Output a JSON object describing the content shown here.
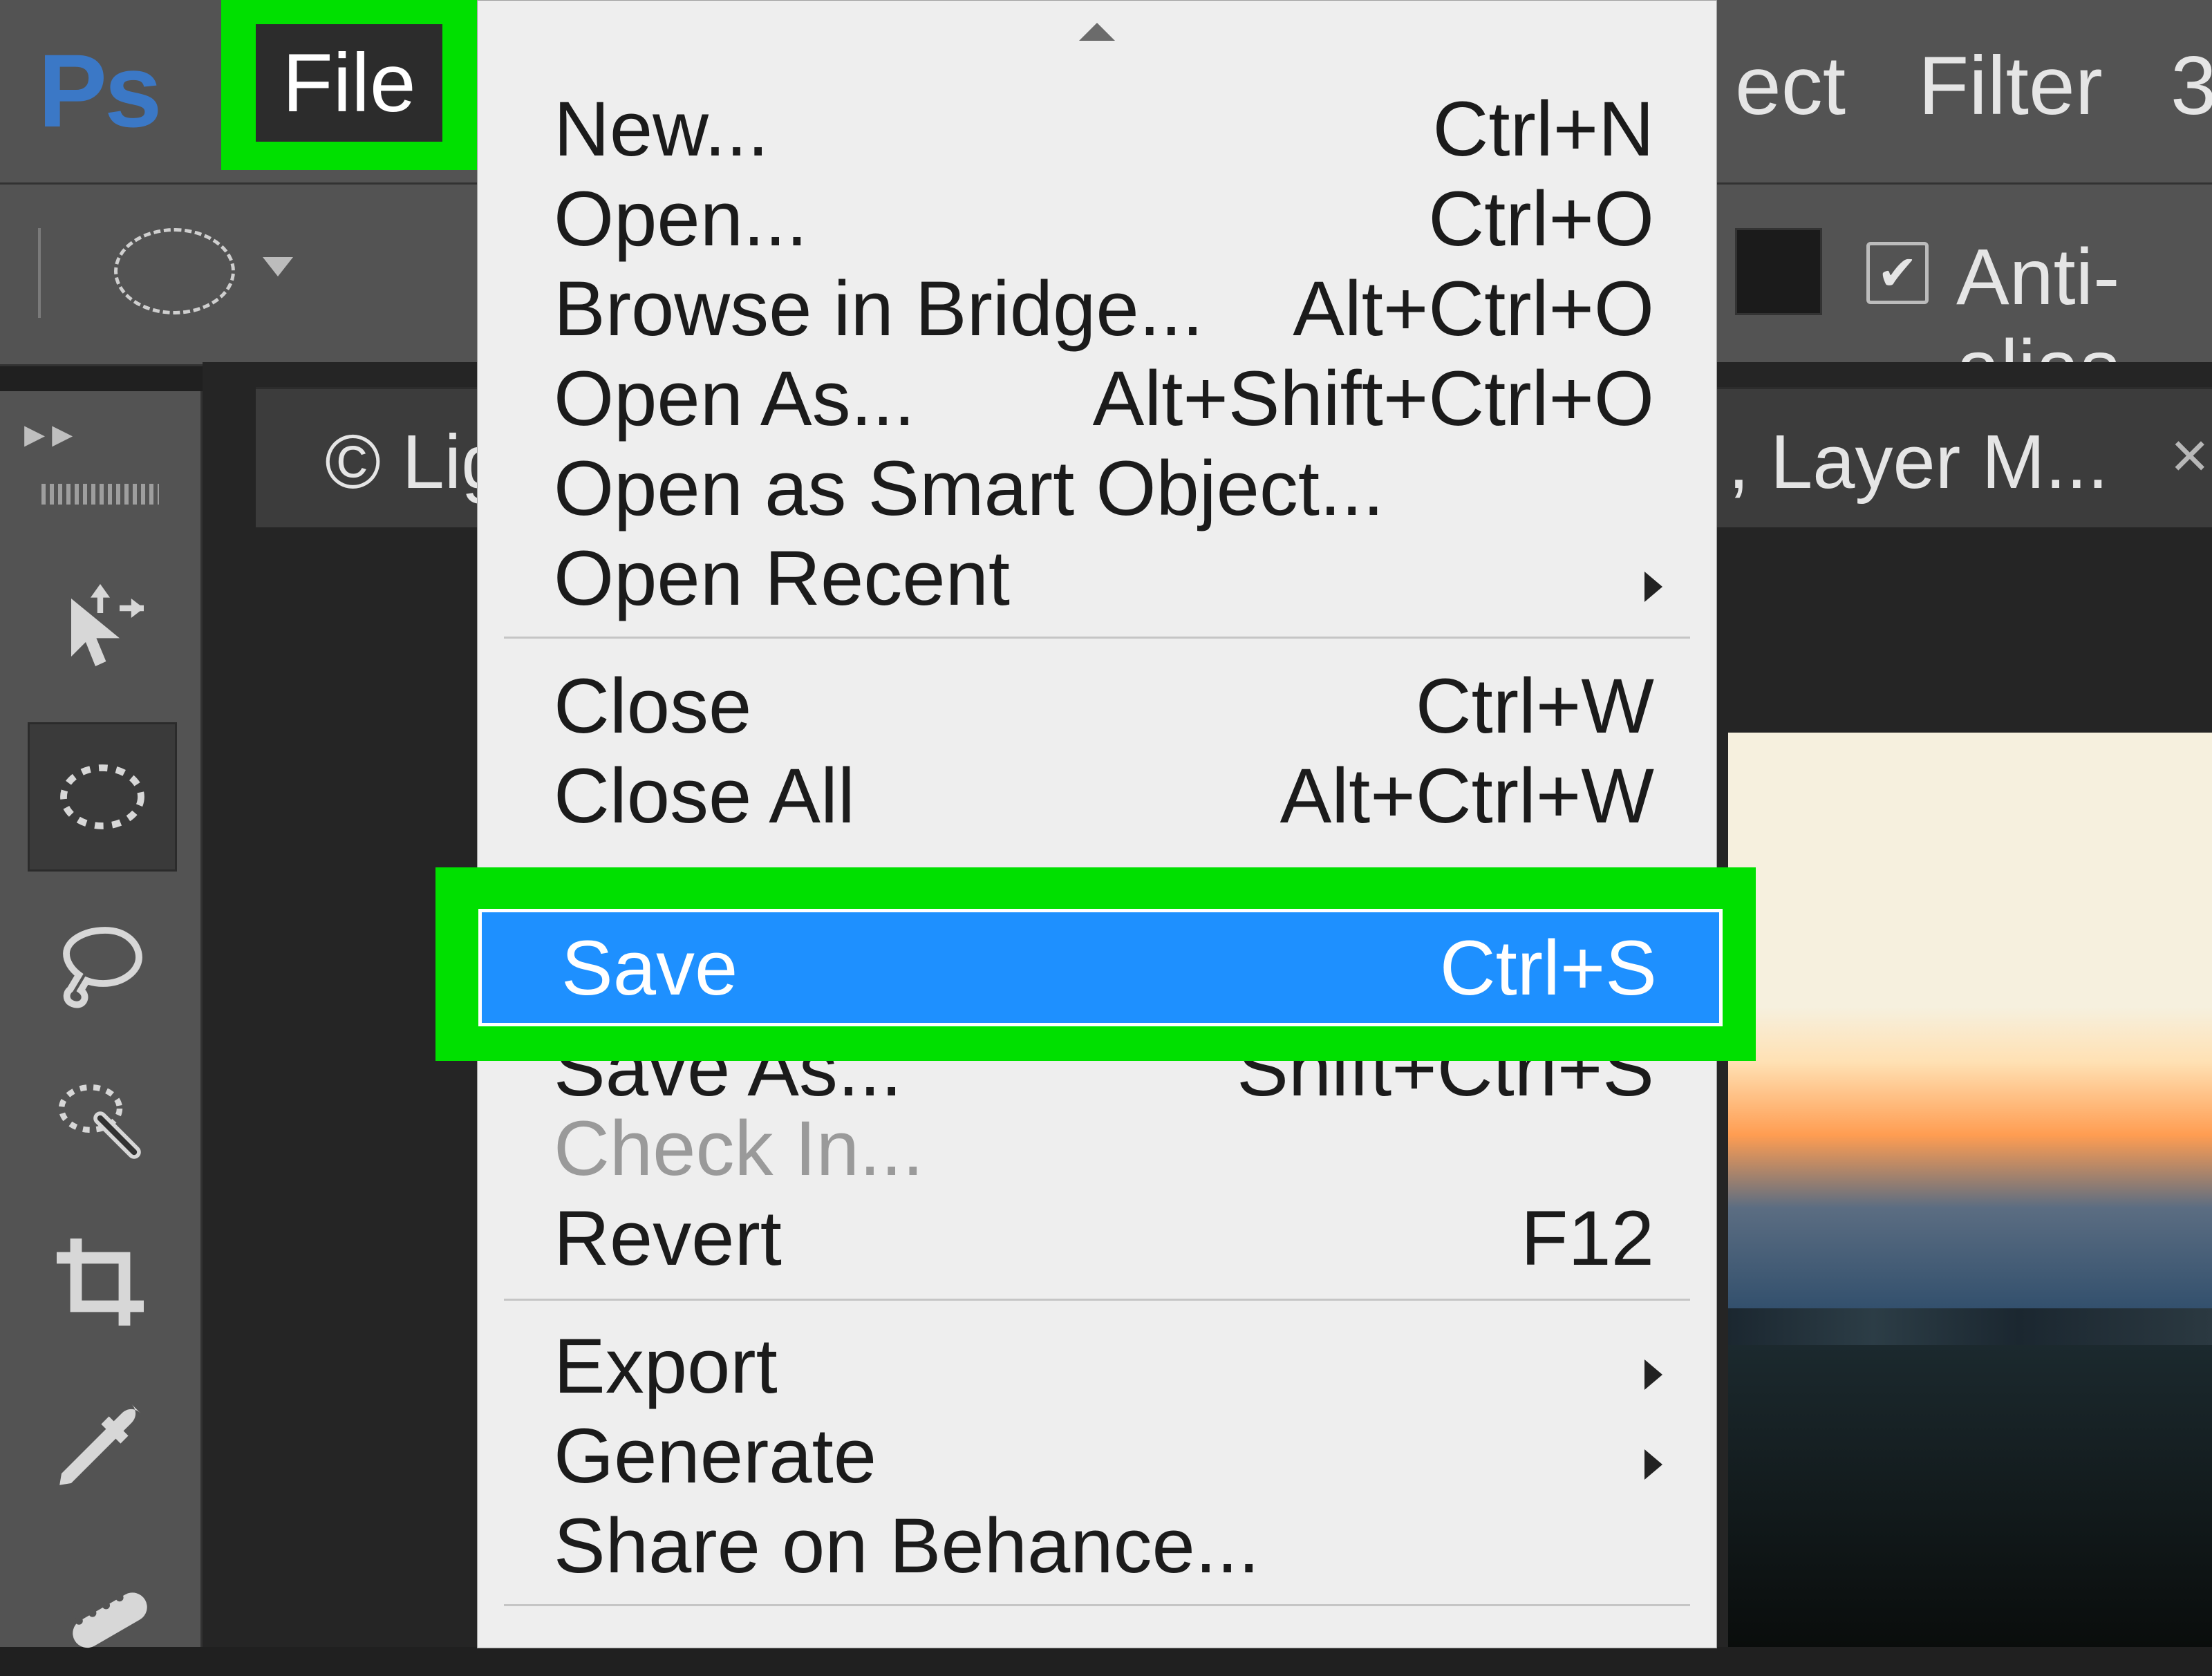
{
  "app": {
    "logo": "Ps"
  },
  "menubar": {
    "file_label": "File",
    "right_items": [
      "ect",
      "Filter",
      "3"
    ]
  },
  "options": {
    "anti_alias_label": "Anti-alias",
    "anti_alias_checked": true
  },
  "document": {
    "title_left": "© Lig",
    "title_right": ", Layer M...",
    "close_glyph": "×"
  },
  "tools": [
    {
      "id": "move",
      "name": "move-tool"
    },
    {
      "id": "marquee",
      "name": "elliptical-marquee-tool",
      "selected": true
    },
    {
      "id": "lasso",
      "name": "lasso-tool"
    },
    {
      "id": "quickselect",
      "name": "quick-selection-tool"
    },
    {
      "id": "crop",
      "name": "crop-tool"
    },
    {
      "id": "eyedrop",
      "name": "eyedropper-tool"
    },
    {
      "id": "healing",
      "name": "healing-brush-tool"
    }
  ],
  "file_menu": {
    "groups": [
      [
        {
          "label": "New...",
          "shortcut": "Ctrl+N"
        },
        {
          "label": "Open...",
          "shortcut": "Ctrl+O"
        },
        {
          "label": "Browse in Bridge...",
          "shortcut": "Alt+Ctrl+O"
        },
        {
          "label": "Open As...",
          "shortcut": "Alt+Shift+Ctrl+O"
        },
        {
          "label": "Open as Smart Object..."
        },
        {
          "label": "Open Recent",
          "submenu": true
        }
      ],
      [
        {
          "label": "Close",
          "shortcut": "Ctrl+W"
        },
        {
          "label": "Close All",
          "shortcut": "Alt+Ctrl+W"
        },
        {
          "label": "Save",
          "shortcut": "Ctrl+S",
          "highlight": true
        },
        {
          "label": "Save As...",
          "shortcut": "Shift+Ctrl+S"
        },
        {
          "label": "Check In...",
          "disabled": true
        },
        {
          "label": "Revert",
          "shortcut": "F12"
        }
      ],
      [
        {
          "label": "Export",
          "submenu": true
        },
        {
          "label": "Generate",
          "submenu": true
        },
        {
          "label": "Share on Behance..."
        }
      ]
    ]
  }
}
